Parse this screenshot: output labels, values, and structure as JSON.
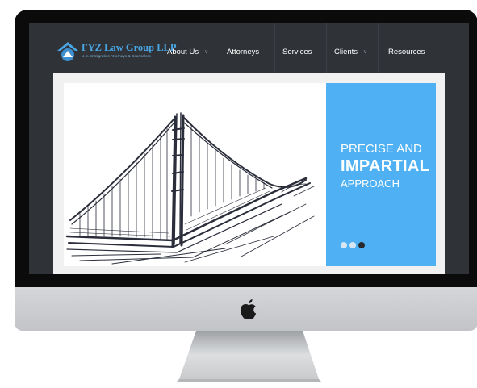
{
  "brand": {
    "name": "FYZ Law Group LLP",
    "tagline": "U.S. Immigration Attorneys & Counselors"
  },
  "nav": {
    "items": [
      {
        "label": "About Us",
        "has_dropdown": true
      },
      {
        "label": "Attorneys",
        "has_dropdown": false
      },
      {
        "label": "Services",
        "has_dropdown": false
      },
      {
        "label": "Clients",
        "has_dropdown": true
      },
      {
        "label": "Resources",
        "has_dropdown": false
      }
    ],
    "dropdown_icon": "chevron-down-icon"
  },
  "hero": {
    "image": "golden-gate-bridge-sketch",
    "promo": {
      "line1": "PRECISE AND",
      "line2": "IMPARTIAL",
      "line3": "APPROACH"
    },
    "slides": {
      "count": 3,
      "active_index": 2
    }
  },
  "device": {
    "logo_icon": "apple-logo-icon"
  },
  "colors": {
    "accent": "#4fb1f3",
    "brand_blue": "#49a6e5",
    "screen_bg": "#2f3338",
    "dot_inactive": "#d6e6f2",
    "dot_active": "#262a2f"
  }
}
